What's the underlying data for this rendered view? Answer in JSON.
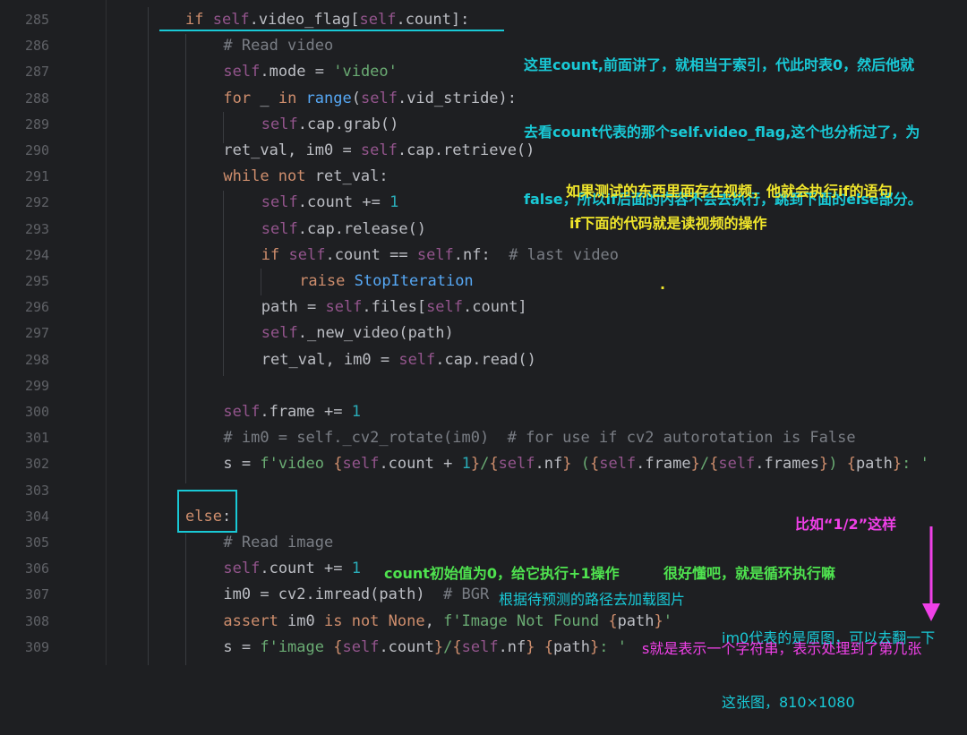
{
  "editor": {
    "line_numbers": [
      "285",
      "286",
      "287",
      "288",
      "289",
      "290",
      "291",
      "292",
      "293",
      "294",
      "295",
      "296",
      "297",
      "298",
      "299",
      "300",
      "301",
      "302",
      "303",
      "304",
      "305",
      "306",
      "307",
      "308",
      "309"
    ],
    "lines": [
      [
        {
          "t": "if ",
          "c": "kw"
        },
        {
          "t": "self",
          "c": "slf"
        },
        {
          "t": ".video_flag[",
          "c": ""
        },
        {
          "t": "self",
          "c": "slf"
        },
        {
          "t": ".count]:",
          "c": ""
        }
      ],
      [
        {
          "t": "# Read video",
          "c": "cmt"
        }
      ],
      [
        {
          "t": "self",
          "c": "slf"
        },
        {
          "t": ".mode = ",
          "c": ""
        },
        {
          "t": "'video'",
          "c": "str"
        }
      ],
      [
        {
          "t": "for",
          "c": "kw"
        },
        {
          "t": " _ ",
          "c": ""
        },
        {
          "t": "in",
          "c": "kw"
        },
        {
          "t": " ",
          "c": ""
        },
        {
          "t": "range",
          "c": "fn"
        },
        {
          "t": "(",
          "c": ""
        },
        {
          "t": "self",
          "c": "slf"
        },
        {
          "t": ".vid_stride):",
          "c": ""
        }
      ],
      [
        {
          "t": "self",
          "c": "slf"
        },
        {
          "t": ".cap.grab()",
          "c": ""
        }
      ],
      [
        {
          "t": "ret_val, im0 = ",
          "c": ""
        },
        {
          "t": "self",
          "c": "slf"
        },
        {
          "t": ".cap.retrieve()",
          "c": ""
        }
      ],
      [
        {
          "t": "while not",
          "c": "kw"
        },
        {
          "t": " ret_val:",
          "c": ""
        }
      ],
      [
        {
          "t": "self",
          "c": "slf"
        },
        {
          "t": ".count += ",
          "c": ""
        },
        {
          "t": "1",
          "c": "num"
        }
      ],
      [
        {
          "t": "self",
          "c": "slf"
        },
        {
          "t": ".cap.release()",
          "c": ""
        }
      ],
      [
        {
          "t": "if ",
          "c": "kw"
        },
        {
          "t": "self",
          "c": "slf"
        },
        {
          "t": ".count == ",
          "c": ""
        },
        {
          "t": "self",
          "c": "slf"
        },
        {
          "t": ".nf:  ",
          "c": ""
        },
        {
          "t": "# last video",
          "c": "cmt"
        }
      ],
      [
        {
          "t": "raise ",
          "c": "kw"
        },
        {
          "t": "StopIteration",
          "c": "fn"
        }
      ],
      [
        {
          "t": "path = ",
          "c": ""
        },
        {
          "t": "self",
          "c": "slf"
        },
        {
          "t": ".files[",
          "c": ""
        },
        {
          "t": "self",
          "c": "slf"
        },
        {
          "t": ".count]",
          "c": ""
        }
      ],
      [
        {
          "t": "self",
          "c": "slf"
        },
        {
          "t": "._new_video(path)",
          "c": ""
        }
      ],
      [
        {
          "t": "ret_val, im0 = ",
          "c": ""
        },
        {
          "t": "self",
          "c": "slf"
        },
        {
          "t": ".cap.read()",
          "c": ""
        }
      ],
      [],
      [
        {
          "t": "self",
          "c": "slf"
        },
        {
          "t": ".frame += ",
          "c": ""
        },
        {
          "t": "1",
          "c": "num"
        }
      ],
      [
        {
          "t": "# im0 = self._cv2_rotate(im0)  # for use if cv2 autorotation is False",
          "c": "cmt"
        }
      ],
      [
        {
          "t": "s = ",
          "c": ""
        },
        {
          "t": "f'video ",
          "c": "str"
        },
        {
          "t": "{",
          "c": "brace"
        },
        {
          "t": "self",
          "c": "slf"
        },
        {
          "t": ".count + ",
          "c": ""
        },
        {
          "t": "1",
          "c": "num"
        },
        {
          "t": "}",
          "c": "brace"
        },
        {
          "t": "/",
          "c": "str"
        },
        {
          "t": "{",
          "c": "brace"
        },
        {
          "t": "self",
          "c": "slf"
        },
        {
          "t": ".nf",
          "c": ""
        },
        {
          "t": "}",
          "c": "brace"
        },
        {
          "t": " (",
          "c": "str"
        },
        {
          "t": "{",
          "c": "brace"
        },
        {
          "t": "self",
          "c": "slf"
        },
        {
          "t": ".frame",
          "c": ""
        },
        {
          "t": "}",
          "c": "brace"
        },
        {
          "t": "/",
          "c": "str"
        },
        {
          "t": "{",
          "c": "brace"
        },
        {
          "t": "self",
          "c": "slf"
        },
        {
          "t": ".frames",
          "c": ""
        },
        {
          "t": "}",
          "c": "brace"
        },
        {
          "t": ") ",
          "c": "str"
        },
        {
          "t": "{",
          "c": "brace"
        },
        {
          "t": "path",
          "c": ""
        },
        {
          "t": "}",
          "c": "brace"
        },
        {
          "t": ": '",
          "c": "str"
        }
      ],
      [],
      [
        {
          "t": "else",
          "c": "kw"
        },
        {
          "t": ":",
          "c": ""
        }
      ],
      [
        {
          "t": "# Read image",
          "c": "cmt"
        }
      ],
      [
        {
          "t": "self",
          "c": "slf"
        },
        {
          "t": ".count += ",
          "c": ""
        },
        {
          "t": "1",
          "c": "num"
        }
      ],
      [
        {
          "t": "im0 = cv2.imread(path)  ",
          "c": ""
        },
        {
          "t": "# BGR",
          "c": "cmt"
        }
      ],
      [
        {
          "t": "assert ",
          "c": "kw"
        },
        {
          "t": "im0 ",
          "c": ""
        },
        {
          "t": "is not None",
          "c": "kw"
        },
        {
          "t": ", ",
          "c": ""
        },
        {
          "t": "f'Image Not Found ",
          "c": "str"
        },
        {
          "t": "{",
          "c": "brace"
        },
        {
          "t": "path",
          "c": ""
        },
        {
          "t": "}",
          "c": "brace"
        },
        {
          "t": "'",
          "c": "str"
        }
      ],
      [
        {
          "t": "s = ",
          "c": ""
        },
        {
          "t": "f'image ",
          "c": "str"
        },
        {
          "t": "{",
          "c": "brace"
        },
        {
          "t": "self",
          "c": "slf"
        },
        {
          "t": ".count",
          "c": ""
        },
        {
          "t": "}",
          "c": "brace"
        },
        {
          "t": "/",
          "c": "str"
        },
        {
          "t": "{",
          "c": "brace"
        },
        {
          "t": "self",
          "c": "slf"
        },
        {
          "t": ".nf",
          "c": ""
        },
        {
          "t": "}",
          "c": "brace"
        },
        {
          "t": " ",
          "c": "str"
        },
        {
          "t": "{",
          "c": "brace"
        },
        {
          "t": "path",
          "c": ""
        },
        {
          "t": "}",
          "c": "brace"
        },
        {
          "t": ": '",
          "c": "str"
        }
      ]
    ],
    "colors": {
      "background": "#1e1f22",
      "keyword": "#cf8e6d",
      "self": "#94558d",
      "function": "#56a8f5",
      "number": "#2aacb8",
      "string": "#6aab73",
      "comment": "#7a7e85",
      "annotation_cyan": "#19c9d6",
      "annotation_yellow": "#f0e62b",
      "annotation_green": "#4fe34f",
      "annotation_magenta": "#f040e8"
    }
  },
  "annotations": {
    "top_note": [
      "这里count,前面讲了，就相当于索引，代此时表0，然后他就",
      "去看count代表的那个self.video_flag,这个也分析过了，为",
      "false，所以if后面的内容不会去执行，跳到下面的else部分。"
    ],
    "video_note_1": "如果测试的东西里面存在视频，他就会执行if的语句",
    "video_note_2": "if下面的代码就是读视频的操作",
    "dot": ".",
    "example_note": "比如“1/2”这样",
    "count_note": "count初始值为0，给它执行+1操作",
    "loop_note": "很好懂吧，就是循环执行嘛",
    "load_note": "根据待预测的路径去加载图片",
    "im0_note": [
      "im0代表的是原图，可以去翻一下",
      "这张图，810×1080"
    ],
    "s_note": "s就是表示一个字符串，表示处理到了第几张"
  }
}
